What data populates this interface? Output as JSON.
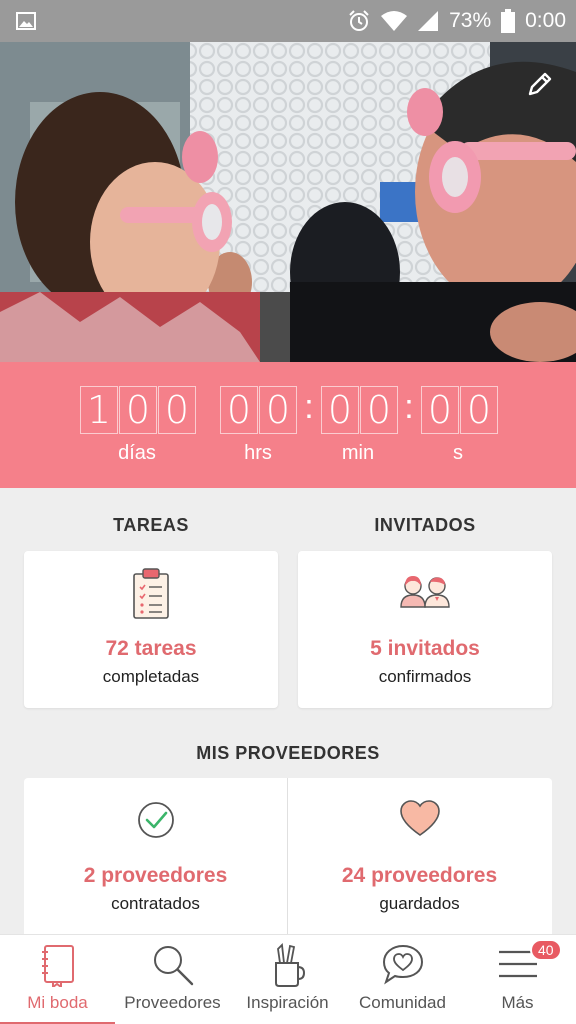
{
  "status_bar": {
    "battery_percent": "73%",
    "time": "0:00"
  },
  "hero": {
    "title": ""
  },
  "countdown": {
    "days": [
      "1",
      "0",
      "0"
    ],
    "hours": [
      "0",
      "0"
    ],
    "minutes": [
      "0",
      "0"
    ],
    "seconds": [
      "0",
      "0"
    ],
    "separator": ":",
    "labels": {
      "days": "días",
      "hours": "hrs",
      "minutes": "min",
      "seconds": "s"
    }
  },
  "tasks": {
    "title": "TAREAS",
    "count": "72 tareas",
    "subtitle": "completadas"
  },
  "guests": {
    "title": "INVITADOS",
    "count": "5 invitados",
    "subtitle": "confirmados"
  },
  "providers": {
    "title": "MIS PROVEEDORES",
    "hired": {
      "count": "2 proveedores",
      "subtitle": "contratados"
    },
    "saved": {
      "count": "24 proveedores",
      "subtitle": "guardados"
    }
  },
  "bottom_nav": {
    "items": [
      {
        "label": "Mi boda",
        "icon": "notebook-icon",
        "active": true
      },
      {
        "label": "Proveedores",
        "icon": "search-icon"
      },
      {
        "label": "Inspiración",
        "icon": "pencil-cup-icon"
      },
      {
        "label": "Comunidad",
        "icon": "chat-heart-icon"
      },
      {
        "label": "Más",
        "icon": "menu-icon",
        "badge": "40"
      }
    ]
  },
  "colors": {
    "accent": "#f5808a",
    "accent_text": "#e06a6f",
    "status_bar": "#9a9a9a"
  }
}
